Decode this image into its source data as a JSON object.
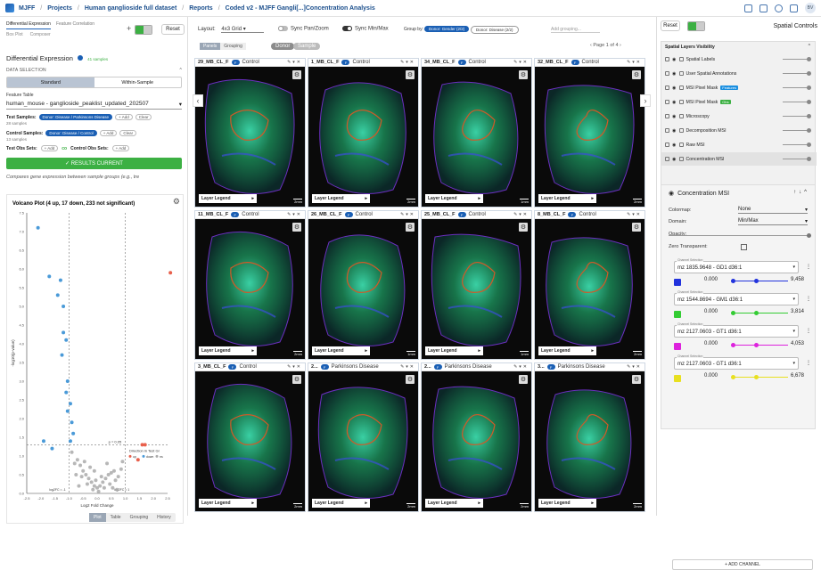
{
  "topbar": {
    "crumbs": [
      "MJFF",
      "Projects",
      "Human ganglioside full dataset",
      "Reports",
      "Coded v2 - MJFF Gangli[...]Concentration Analysis"
    ],
    "avatar": "BV"
  },
  "left": {
    "tabs": [
      "Differential Expression",
      "Feature Correlation"
    ],
    "tabs2": [
      "Box Plot",
      "Composer"
    ],
    "reset": "Reset",
    "title": "Differential Expression",
    "samples": "41 samples",
    "data_selection": "DATA SELECTION",
    "modes": [
      "Standard",
      "Within-Sample"
    ],
    "feature_table_label": "Feature Table",
    "feature_table": "human_mouse - ganglioside_peaklist_updated_202507",
    "test_samples_label": "Test Samples:",
    "test_chip": "Donor: Disease / Parkinsons Disease",
    "add": "+ Add",
    "clear": "Clear",
    "test_count": "28 samples",
    "control_samples_label": "Control Samples:",
    "control_chip": "Donor: Disease / Control",
    "control_count": "13 samples",
    "test_obs": "Test Obs Sets:",
    "control_obs": "Control Obs Sets:",
    "co": "co",
    "results_btn": "✓ RESULTS CURRENT",
    "desc": "Compares gene expression between sample groups (e.g., tre",
    "bottom_tabs": [
      "Plot",
      "Table",
      "Grouping",
      "History"
    ]
  },
  "chart_data": {
    "type": "scatter",
    "title": "Volcano Plot (4 up, 17 down, 233 not significant)",
    "xlabel": "Log2 Fold Change",
    "ylabel": "-log10(p-value)",
    "ylim": [
      0,
      7.5
    ],
    "yticks": [
      "7.5",
      "7.0",
      "6.5",
      "6.0",
      "5.5",
      "5.0",
      "4.5",
      "4.0",
      "3.5",
      "3.0",
      "2.5",
      "2.0",
      "1.5",
      "1.0",
      "0.5",
      "0.0"
    ],
    "xticks": [
      "-2.5",
      "-2.0",
      "-1.5",
      "-1.0",
      "-0.5",
      "0.0",
      "0.5",
      "1.0",
      "1.5",
      "2.0",
      "2.5"
    ],
    "threshold_label": "p = 0.05",
    "fc_label_left": "log2FC = -1",
    "fc_label_right": "log2FC = 1",
    "legend_title": "Direction in Test Gr",
    "legend": [
      "up",
      "down",
      "ns"
    ],
    "colors": {
      "up": "#e8604c",
      "down": "#4a9ad8",
      "ns": "#aaaaaa"
    },
    "up_points": [
      [
        2.6,
        5.9
      ],
      [
        1.6,
        1.3
      ],
      [
        1.7,
        1.3
      ],
      [
        1.45,
        0.9
      ]
    ],
    "down_points": [
      [
        -2.1,
        7.1
      ],
      [
        -1.7,
        5.8
      ],
      [
        -1.3,
        5.7
      ],
      [
        -1.4,
        5.3
      ],
      [
        -1.2,
        5.0
      ],
      [
        -1.2,
        4.3
      ],
      [
        -1.1,
        4.1
      ],
      [
        -1.25,
        3.7
      ],
      [
        -1.05,
        3.0
      ],
      [
        -1.1,
        2.7
      ],
      [
        -0.95,
        2.4
      ],
      [
        -1.9,
        1.4
      ],
      [
        -1.6,
        1.2
      ],
      [
        -0.9,
        1.9
      ],
      [
        -0.85,
        1.6
      ],
      [
        -1.05,
        2.2
      ],
      [
        -0.95,
        1.4
      ]
    ],
    "ns_points": [
      [
        -0.9,
        1.1
      ],
      [
        -0.7,
        0.9
      ],
      [
        -0.6,
        0.75
      ],
      [
        -0.5,
        0.6
      ],
      [
        -0.4,
        0.5
      ],
      [
        -0.3,
        0.4
      ],
      [
        -0.2,
        0.3
      ],
      [
        -0.1,
        0.2
      ],
      [
        0.0,
        0.15
      ],
      [
        0.1,
        0.2
      ],
      [
        0.2,
        0.3
      ],
      [
        0.3,
        0.4
      ],
      [
        0.4,
        0.5
      ],
      [
        0.5,
        0.55
      ],
      [
        0.6,
        0.6
      ],
      [
        -0.8,
        0.8
      ],
      [
        -0.55,
        0.45
      ],
      [
        -0.35,
        0.25
      ],
      [
        -0.15,
        0.1
      ],
      [
        0.05,
        0.05
      ],
      [
        0.25,
        0.15
      ],
      [
        0.45,
        0.25
      ],
      [
        0.65,
        0.35
      ],
      [
        0.75,
        0.45
      ],
      [
        0.85,
        0.65
      ],
      [
        0.35,
        0.8
      ],
      [
        -0.25,
        0.7
      ],
      [
        -0.45,
        0.85
      ],
      [
        0.15,
        0.45
      ],
      [
        -0.05,
        0.35
      ],
      [
        0.55,
        0.15
      ],
      [
        -0.65,
        0.2
      ],
      [
        0.7,
        0.1
      ],
      [
        -0.75,
        0.5
      ],
      [
        0.9,
        0.85
      ],
      [
        -0.1,
        0.6
      ]
    ]
  },
  "center": {
    "layout_label": "Layout:",
    "layout_value": "4x3 Grid",
    "sync_pan": "Sync Pan/Zoom",
    "sync_minmax": "Sync Min/Max",
    "group_by": "Group by:",
    "group_chip1": "Donor: Gender (2/2)",
    "group_chip2": "Donor: Disease (2/2)",
    "add_grouping": "Add grouping...",
    "page": "Page 1 of 4",
    "view_tabs": [
      "Panels",
      "Grouping"
    ],
    "filter_pills": [
      "Donor",
      "Sample"
    ],
    "legend_label": "Layer Legend",
    "panels": [
      {
        "name": "29_MB_CL_F",
        "group": "Control",
        "scale": "2mm"
      },
      {
        "name": "1_MB_CL_F",
        "group": "Control",
        "scale": "2mm"
      },
      {
        "name": "34_MB_CL_F",
        "group": "Control",
        "scale": "1mm"
      },
      {
        "name": "32_MB_CL_F",
        "group": "Control",
        "scale": "2mm"
      },
      {
        "name": "11_MB_CL_F",
        "group": "Control",
        "scale": "2mm"
      },
      {
        "name": "26_MB_CL_F",
        "group": "Control",
        "scale": "1mm"
      },
      {
        "name": "25_MB_CL_F",
        "group": "Control",
        "scale": "1mm"
      },
      {
        "name": "8_MB_CL_F",
        "group": "Control",
        "scale": "2mm"
      },
      {
        "name": "3_MB_CL_F",
        "group": "Control",
        "scale": "2mm"
      },
      {
        "name": "2...",
        "group": "Parkinsons Disease",
        "scale": "2mm"
      },
      {
        "name": "2...",
        "group": "Parkinsons Disease",
        "scale": "2mm"
      },
      {
        "name": "3...",
        "group": "Parkinsons Disease",
        "scale": "2mm"
      }
    ]
  },
  "right": {
    "reset": "Reset",
    "title": "Spatial Controls",
    "layers_title": "Spatial Layers Visibility",
    "layers": [
      {
        "name": "Spatial Labels",
        "badge": "",
        "badge_color": ""
      },
      {
        "name": "User Spatial Annotations",
        "badge": "",
        "badge_color": ""
      },
      {
        "name": "MSI Pixel Mask",
        "badge": "Features",
        "badge_color": "#1a8fe0"
      },
      {
        "name": "MSI Pixel Mask",
        "badge": "Obs",
        "badge_color": "#3cb043"
      },
      {
        "name": "Microscopy",
        "badge": "",
        "badge_color": ""
      },
      {
        "name": "Decomposition MSI",
        "badge": "",
        "badge_color": ""
      },
      {
        "name": "Raw MSI",
        "badge": "",
        "badge_color": ""
      },
      {
        "name": "Concentration MSI",
        "badge": "",
        "badge_color": ""
      }
    ],
    "cmsi_title": "Concentration MSI",
    "colormap_label": "Colormap:",
    "colormap": "None",
    "domain_label": "Domain:",
    "domain": "Min/Max",
    "opacity_label": "Opacity:",
    "opacity": 1.0,
    "zero_label": "Zero Transparent:",
    "channel_label": "Channel Selection",
    "channels": [
      {
        "name": "mz 1835.9648 - GD1 d36:1",
        "min": "0.000",
        "max": "9,458",
        "color": "#2233dd"
      },
      {
        "name": "mz 1544.8694 - GM1 d36:1",
        "min": "0.000",
        "max": "3,814",
        "color": "#33cc33"
      },
      {
        "name": "mz 2127.0603 - GT1 d36:1",
        "min": "0.000",
        "max": "4,053",
        "color": "#dd22dd"
      },
      {
        "name": "mz 2127.0603 - GT1 d36:1",
        "min": "0.000",
        "max": "6,678",
        "color": "#e8e020"
      }
    ],
    "add_channel": "+ ADD CHANNEL"
  }
}
